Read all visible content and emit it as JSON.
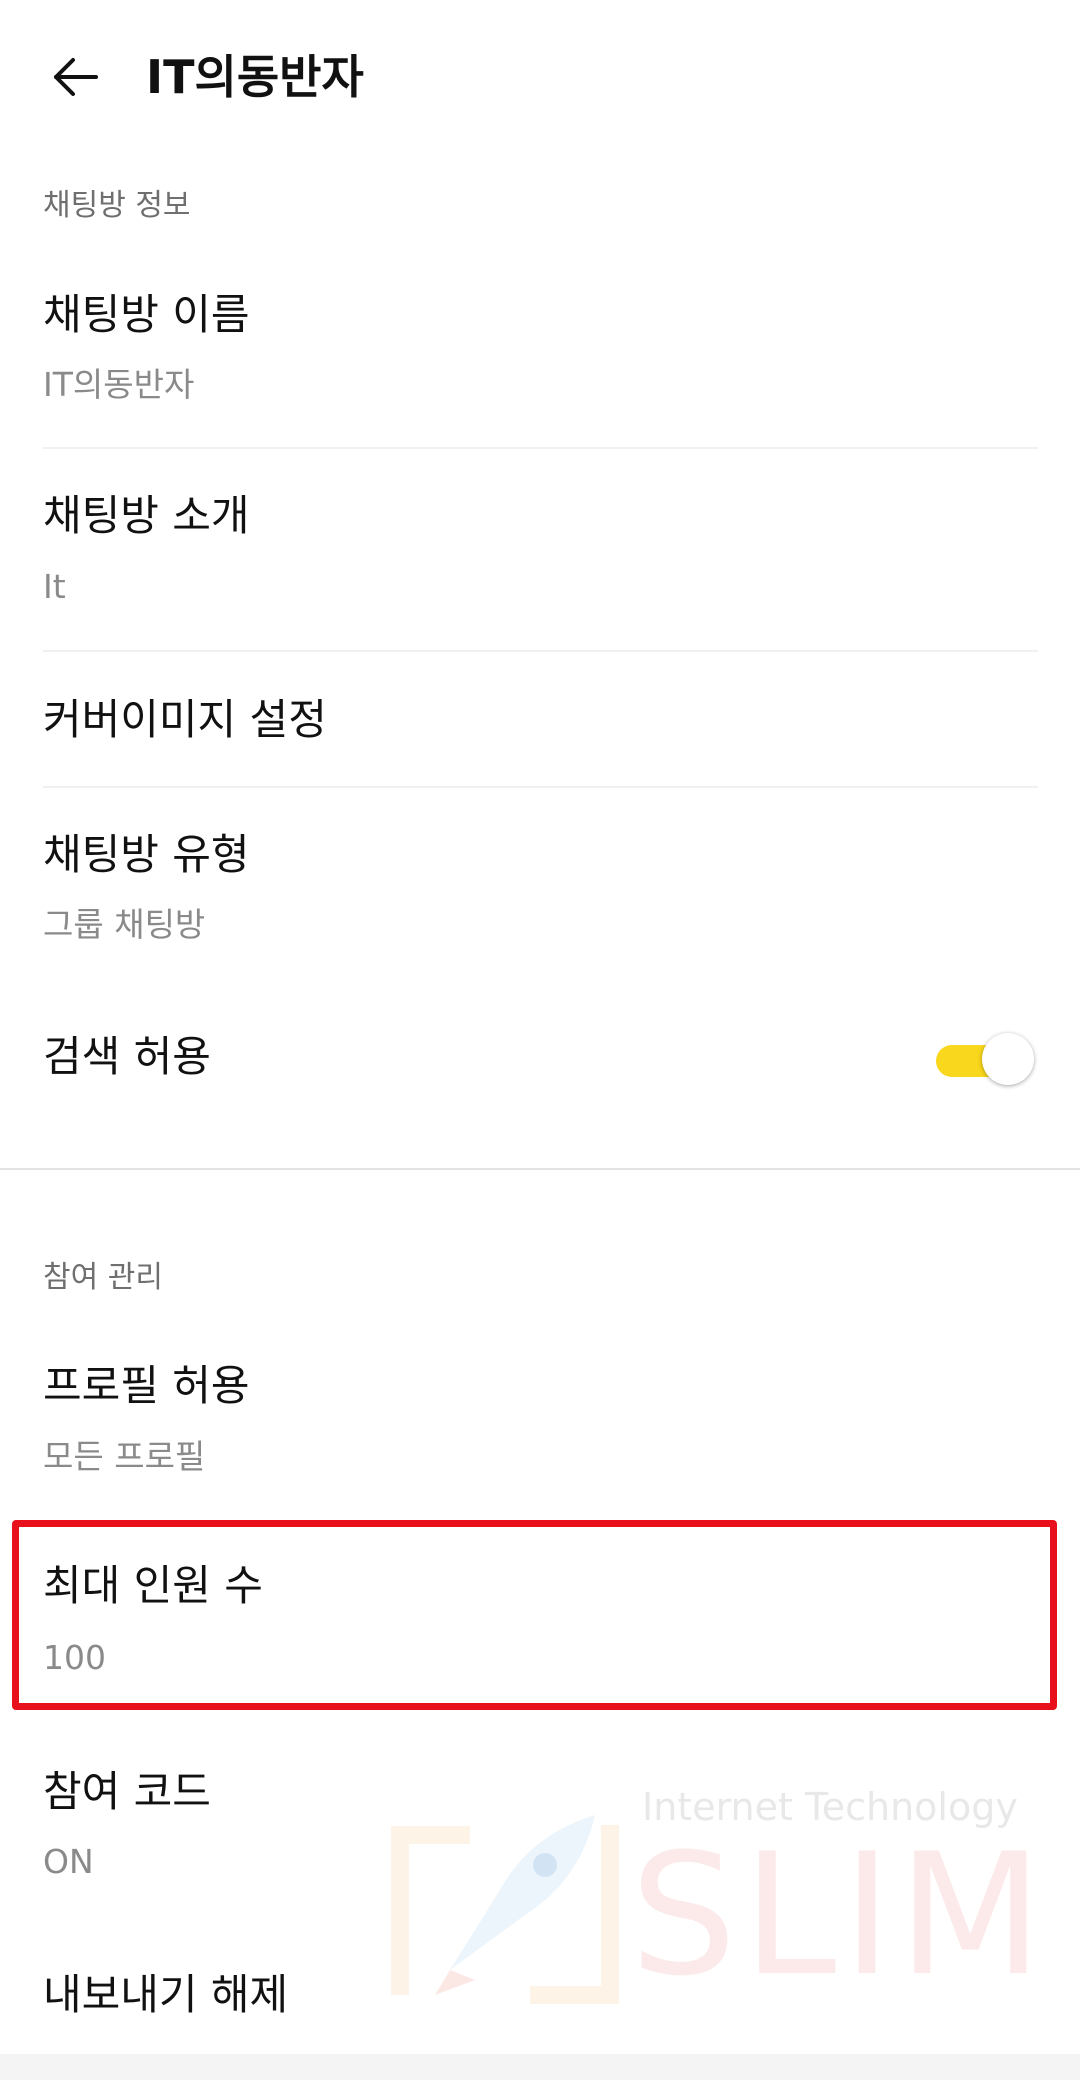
{
  "header": {
    "title": "IT의동반자",
    "back_icon": "arrow-left-icon"
  },
  "sections": {
    "chat_info": {
      "caption": "채팅방 정보",
      "name": {
        "title": "채팅방 이름",
        "value": "IT의동반자"
      },
      "intro": {
        "title": "채팅방 소개",
        "value": "It"
      },
      "cover": {
        "title": "커버이미지 설정"
      },
      "type": {
        "title": "채팅방 유형",
        "value": "그룹 채팅방"
      },
      "search": {
        "title": "검색 허용",
        "toggle_on": true
      }
    },
    "participation": {
      "caption": "참여 관리",
      "profile": {
        "title": "프로필 허용",
        "value": "모든 프로필"
      },
      "max_members": {
        "title": "최대 인원 수",
        "value": "100"
      },
      "join_code": {
        "title": "참여 코드",
        "value": "ON"
      },
      "export": {
        "title": "내보내기 해제"
      }
    }
  },
  "watermark": {
    "subtitle": "Internet Technology",
    "brand": "SLIM"
  },
  "colors": {
    "toggle_on": "#f9d71c",
    "highlight": "#e8111b",
    "subtext": "#8a8a8a"
  }
}
